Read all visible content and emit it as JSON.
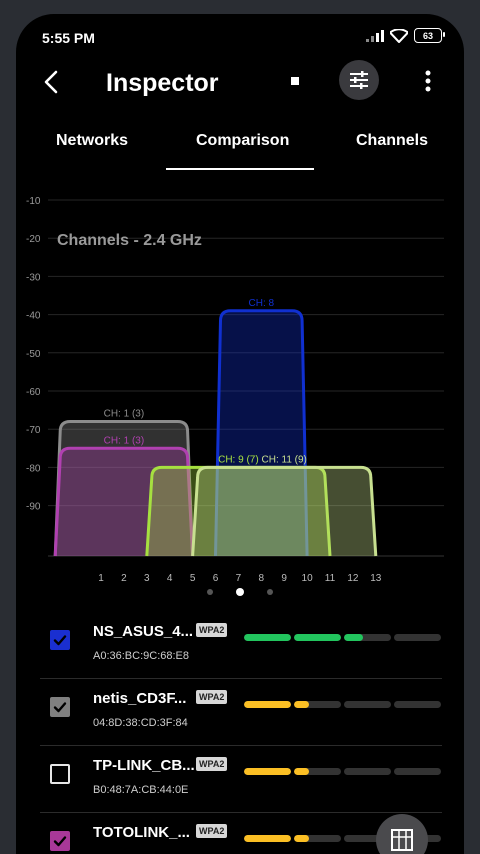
{
  "status": {
    "time": "5:55 PM",
    "battery": "63"
  },
  "appbar": {
    "title": "Inspector"
  },
  "tabs": [
    {
      "label": "Networks",
      "selected": false
    },
    {
      "label": "Comparison",
      "selected": true
    },
    {
      "label": "Channels",
      "selected": false
    }
  ],
  "chart_data": {
    "type": "area",
    "title": "Channels - 2.4 GHz",
    "xlabel": "",
    "ylabel": "",
    "x_ticks": [
      "1",
      "2",
      "3",
      "4",
      "5",
      "6",
      "7",
      "8",
      "9",
      "10",
      "11",
      "12",
      "13"
    ],
    "y_ticks": [
      "-10",
      "-20",
      "-30",
      "-40",
      "-50",
      "-60",
      "-70",
      "-80",
      "-90"
    ],
    "ylim": [
      -100,
      -10
    ],
    "grid": true,
    "series": [
      {
        "label": "CH: 1 (3)",
        "color": "#8c8c8c",
        "from_channel": -1,
        "to_channel": 5,
        "level": -68
      },
      {
        "label": "CH: 1 (3)",
        "color": "#b040b0",
        "from_channel": -1,
        "to_channel": 5,
        "level": -75
      },
      {
        "label": "CH: 8",
        "color": "#1030d0",
        "from_channel": 6,
        "to_channel": 10,
        "level": -39
      },
      {
        "label": "CH: 9 (7)",
        "color": "#a6e040",
        "from_channel": 3,
        "to_channel": 11,
        "level": -80
      },
      {
        "label": "CH: 11 (9)",
        "color": "#c8e090",
        "from_channel": 5,
        "to_channel": 13,
        "level": -80
      }
    ]
  },
  "pager": {
    "count": 3,
    "active": 1
  },
  "networks": [
    {
      "ssid": "NS_ASUS_4...",
      "security": "WPA2",
      "mac": "A0:36:BC:9C:68:E8",
      "checked": true,
      "check_color": "#1a2fd0",
      "signal_fraction": 0.6,
      "signal_color": "#22c55e"
    },
    {
      "ssid": "netis_CD3F...",
      "security": "WPA2",
      "mac": "04:8D:38:CD:3F:84",
      "checked": true,
      "check_color": "#808080",
      "signal_fraction": 0.33,
      "signal_color": "#fbbf24"
    },
    {
      "ssid": "TP-LINK_CB...",
      "security": "WPA2",
      "mac": "B0:48:7A:CB:44:0E",
      "checked": false,
      "check_color": "",
      "signal_fraction": 0.33,
      "signal_color": "#fbbf24"
    },
    {
      "ssid": "TOTOLINK_...",
      "security": "WPA2",
      "mac": "",
      "checked": true,
      "check_color": "#a83898",
      "signal_fraction": 0.33,
      "signal_color": "#fbbf24"
    }
  ]
}
